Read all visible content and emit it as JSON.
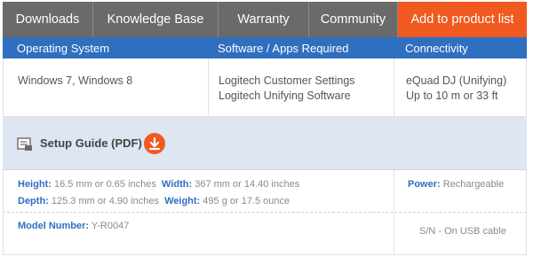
{
  "nav": {
    "tabs": [
      "Downloads",
      "Knowledge Base",
      "Warranty",
      "Community"
    ],
    "cta": "Add to product list"
  },
  "spec_header": {
    "os": "Operating System",
    "software": "Software / Apps Required",
    "connectivity": "Connectivity"
  },
  "compat": {
    "os": "Windows 7, Windows 8",
    "software": [
      "Logitech Customer Settings",
      "Logitech Unifying Software"
    ],
    "connectivity": [
      "eQuad DJ (Unifying)",
      "Up to 10 m or 33 ft"
    ]
  },
  "guide": {
    "label": "Setup Guide (PDF)",
    "doc_icon": "document-icon",
    "download_icon": "download-icon"
  },
  "dimensions": {
    "height_label": "Height:",
    "height_value": "16.5 mm or 0.65 inches",
    "width_label": "Width:",
    "width_value": "367 mm or 14.40 inches",
    "depth_label": "Depth:",
    "depth_value": "125.3 mm or 4.90 inches",
    "weight_label": "Weight:",
    "weight_value": "495 g or 17.5 ounce",
    "power_label": "Power:",
    "power_value": "Rechargeable"
  },
  "model": {
    "label": "Model Number:",
    "value": "Y-R0047",
    "sn": "S/N - On USB cable"
  },
  "colors": {
    "tab_bg": "#6a6a6a",
    "cta_orange": "#f0591f",
    "header_blue": "#2f6fc0",
    "guide_bg": "#dde6f1"
  }
}
